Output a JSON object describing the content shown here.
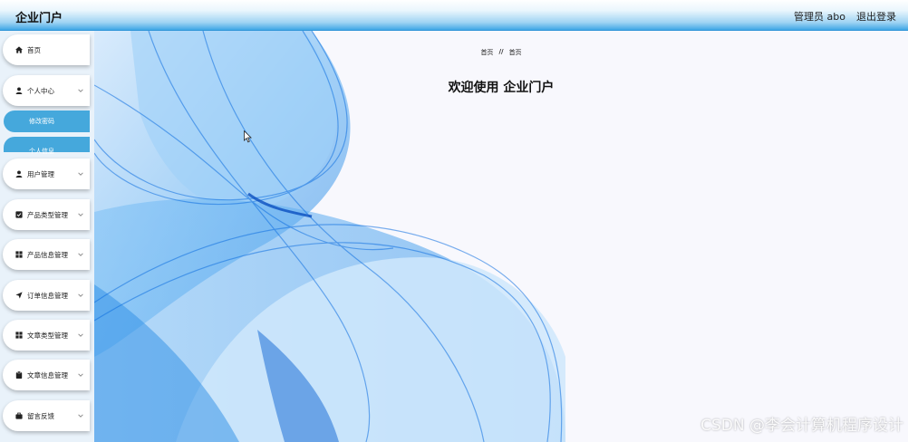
{
  "header": {
    "title": "企业门户",
    "user_label": "管理员 abo",
    "logout_label": "退出登录"
  },
  "sidebar": {
    "items": [
      {
        "label": "首页",
        "icon": "home-icon"
      },
      {
        "label": "个人中心",
        "icon": "user-icon"
      },
      {
        "label": "用户管理",
        "icon": "user-icon"
      },
      {
        "label": "产品类型管理",
        "icon": "checkbox-icon"
      },
      {
        "label": "产品信息管理",
        "icon": "grid-icon"
      },
      {
        "label": "订单信息管理",
        "icon": "send-icon"
      },
      {
        "label": "文章类型管理",
        "icon": "grid-icon"
      },
      {
        "label": "文章信息管理",
        "icon": "clipboard-icon"
      },
      {
        "label": "留言反馈",
        "icon": "briefcase-icon"
      }
    ],
    "sub_items": [
      {
        "label": "修改密码"
      },
      {
        "label": "个人信息"
      }
    ]
  },
  "main": {
    "breadcrumb": {
      "home": "首页",
      "separator": "//",
      "current": "首页"
    },
    "welcome": "欢迎使用 企业门户"
  },
  "watermark": "CSDN @李会计算机程序设计",
  "colors": {
    "accent": "#3fa7e6",
    "submenu": "#45a8dc",
    "wave": "#1e88e5"
  }
}
